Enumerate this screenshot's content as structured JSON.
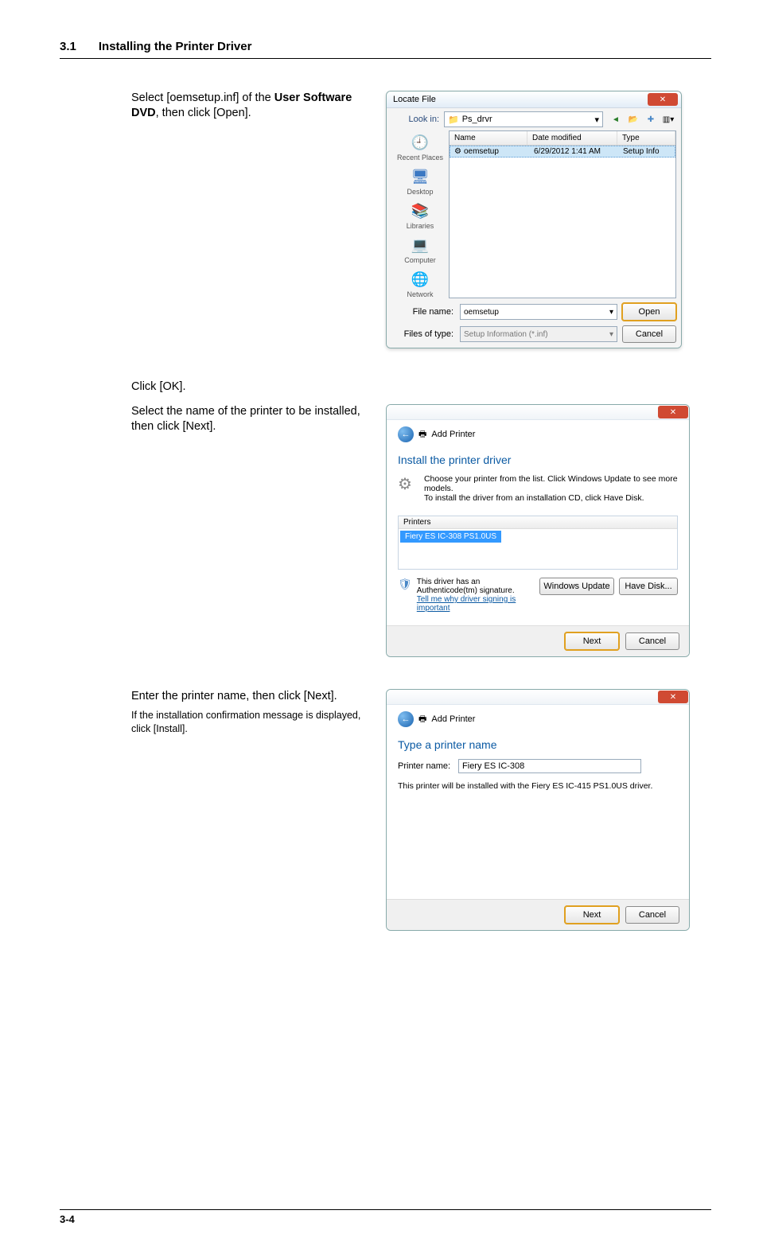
{
  "header": {
    "section_number": "3.1",
    "section_title": "Installing the Printer Driver"
  },
  "step6": {
    "text_prefix": "Select [oemsetup.inf] of the ",
    "bold1": "User Software DVD",
    "text_suffix": ", then click [Open]."
  },
  "locate_file": {
    "title": "Locate File",
    "look_in_label": "Look in:",
    "look_in_value": "Ps_drvr",
    "toolbar": {
      "back": "back",
      "up": "up",
      "new": "new",
      "view": "view"
    },
    "places": {
      "recent": "Recent Places",
      "desktop": "Desktop",
      "libraries": "Libraries",
      "computer": "Computer",
      "network": "Network"
    },
    "columns": {
      "name": "Name",
      "date": "Date modified",
      "type": "Type"
    },
    "row": {
      "name": "oemsetup",
      "date": "6/29/2012 1:41 AM",
      "type": "Setup Info"
    },
    "file_name_label": "File name:",
    "file_name_value": "oemsetup",
    "files_type_label": "Files of type:",
    "files_type_value": "Setup Information (*.inf)",
    "open_btn": "Open",
    "cancel_btn": "Cancel"
  },
  "step7": {
    "text": "Click [OK]."
  },
  "step8": {
    "text": "Select the name of the printer to be installed, then click [Next]."
  },
  "add_printer1": {
    "breadcrumb": "Add Printer",
    "heading": "Install the printer driver",
    "sub1": "Choose your printer from the list. Click Windows Update to see more models.",
    "sub2": "To install the driver from an installation CD, click Have Disk.",
    "list_header": "Printers",
    "list_item": "Fiery ES IC-308 PS1.0US",
    "sign_text": "This driver has an Authenticode(tm) signature.",
    "sign_link": "Tell me why driver signing is important",
    "win_update_btn": "Windows Update",
    "have_disk_btn": "Have Disk...",
    "next_btn": "Next",
    "cancel_btn": "Cancel"
  },
  "step9": {
    "line1": "Enter the printer name, then click [Next].",
    "line2": "If the installation confirmation message is displayed, click [Install]."
  },
  "add_printer2": {
    "breadcrumb": "Add Printer",
    "heading": "Type a printer name",
    "name_label": "Printer name:",
    "name_value": "Fiery ES IC-308",
    "info": "This printer will be installed with the Fiery ES IC-415 PS1.0US driver.",
    "next_btn": "Next",
    "cancel_btn": "Cancel"
  },
  "page_footer": "3-4"
}
